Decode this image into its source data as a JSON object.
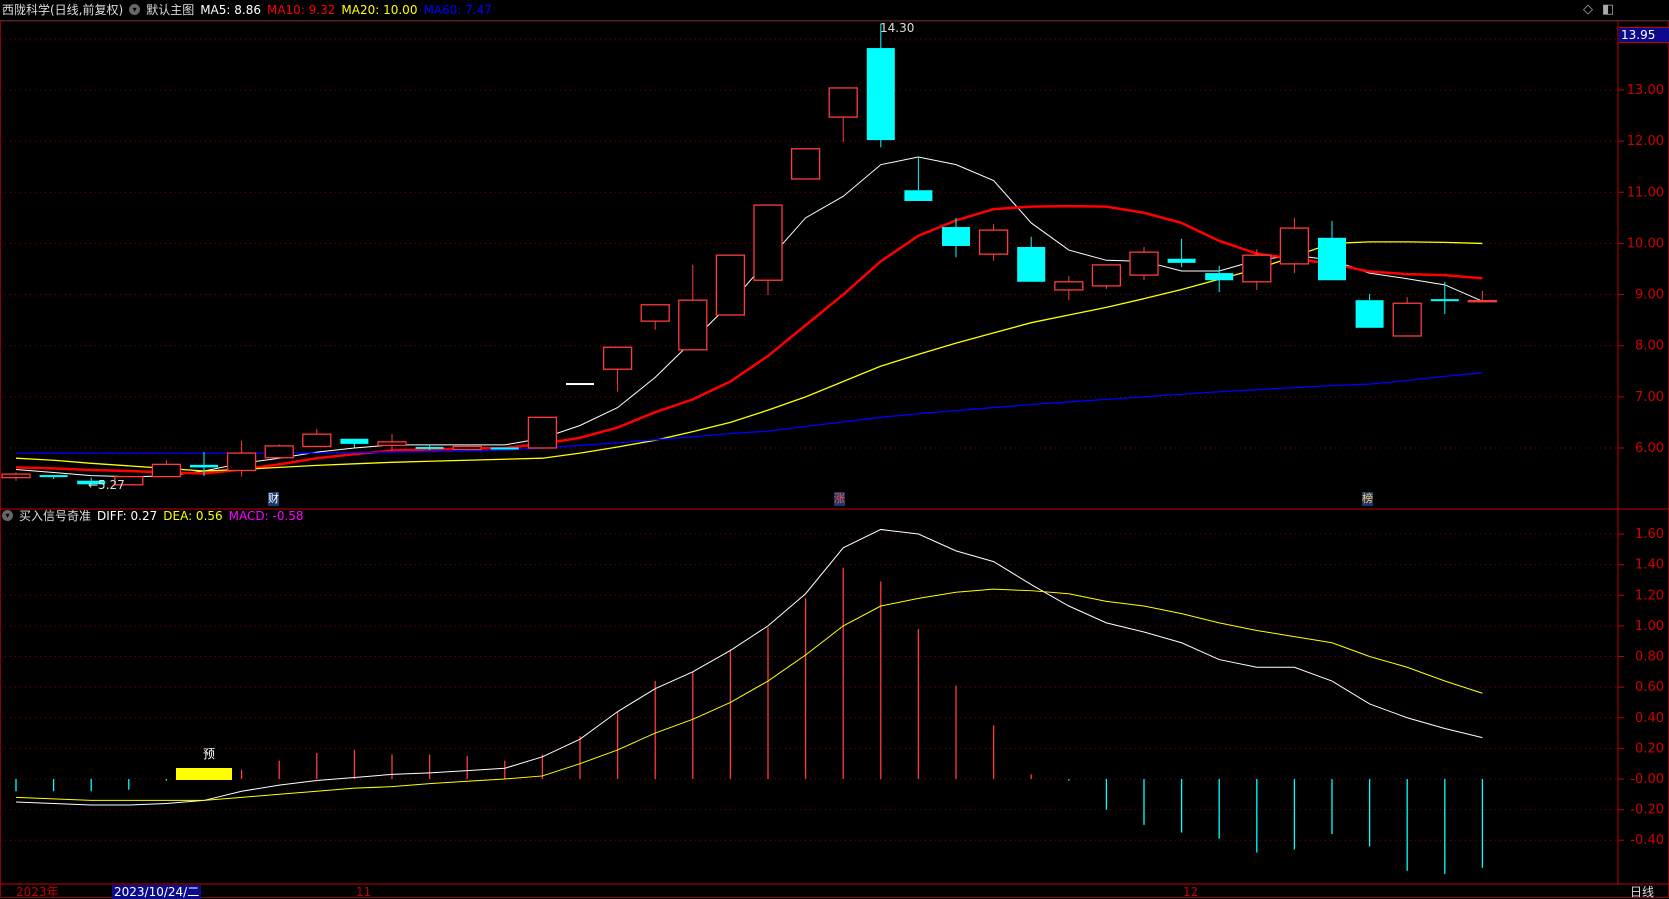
{
  "header": {
    "title": "西陇科学(日线,前复权)",
    "template": "默认主图",
    "ma5": "MA5: 8.86",
    "ma10": "MA10: 9.32",
    "ma20": "MA20: 10.00",
    "ma60": "MA60: 7.47"
  },
  "sub_header": {
    "indicator": "买入信号奇准",
    "diff": "DIFF: 0.27",
    "dea": "DEA: 0.56",
    "macd": "MACD: -0.58"
  },
  "colors": {
    "up": "#ff3b3b",
    "down": "#00ffff",
    "ma5": "#ffffff",
    "ma10": "#ff0000",
    "ma20": "#ffff00",
    "ma60": "#0000ff",
    "grid": "#8b0000",
    "axis": "#c00000"
  },
  "price_cursor_label": "13.95",
  "period_label": "日线",
  "date_bar": {
    "year": "2023年",
    "selected_date": "2023/10/24/二",
    "month_11": "11",
    "month_12": "12"
  },
  "markers": {
    "cai": "财",
    "zhang": "涨",
    "bang": "榜",
    "yu": "预",
    "low_label": "←5.27",
    "high_label": "14.30"
  },
  "chart_data": [
    {
      "type": "candlestick",
      "title": "西陇科学 日线",
      "y_ticks": [
        "13.00",
        "12.00",
        "11.00",
        "10.00",
        "9.00",
        "8.00",
        "7.00",
        "6.00"
      ],
      "ylim": [
        5.2,
        14.4
      ],
      "open": [
        5.42,
        5.47,
        5.36,
        5.28,
        5.44,
        5.67,
        5.56,
        5.81,
        6.03,
        6.18,
        6.05,
        6.02,
        5.97,
        6.01,
        6.0,
        7.27,
        7.54,
        8.48,
        7.92,
        8.6,
        9.28,
        11.26,
        12.47,
        13.82,
        11.04,
        10.32,
        9.79,
        9.93,
        9.09,
        9.17,
        9.38,
        9.7,
        9.42,
        9.25,
        9.6,
        10.11,
        8.89,
        8.19,
        8.91,
        8.86
      ],
      "close": [
        5.49,
        5.43,
        5.29,
        5.44,
        5.68,
        5.62,
        5.9,
        6.04,
        6.27,
        6.08,
        6.12,
        6.01,
        6.03,
        6.0,
        6.6,
        7.27,
        7.97,
        8.8,
        8.89,
        9.77,
        10.75,
        11.85,
        13.04,
        12.02,
        10.83,
        9.95,
        10.26,
        9.25,
        9.25,
        9.58,
        9.83,
        9.62,
        9.28,
        9.77,
        10.3,
        9.28,
        8.35,
        8.83,
        8.91,
        8.88
      ],
      "high": [
        5.52,
        5.47,
        5.42,
        5.44,
        5.76,
        5.92,
        6.14,
        6.07,
        6.37,
        6.18,
        6.27,
        6.06,
        6.05,
        6.01,
        6.6,
        7.27,
        7.97,
        8.8,
        9.58,
        9.77,
        10.75,
        11.85,
        13.04,
        14.3,
        11.69,
        10.5,
        10.38,
        10.13,
        9.36,
        9.58,
        9.93,
        10.09,
        9.56,
        9.89,
        10.5,
        10.44,
        9.01,
        8.95,
        9.25,
        9.07
      ],
      "low": [
        5.36,
        5.39,
        5.27,
        5.27,
        5.44,
        5.45,
        5.44,
        5.81,
        6.03,
        6.01,
        5.94,
        5.96,
        5.95,
        5.99,
        5.98,
        7.27,
        7.1,
        8.31,
        7.92,
        8.6,
        8.99,
        11.26,
        11.98,
        11.88,
        10.83,
        9.73,
        9.66,
        9.25,
        8.89,
        9.11,
        9.28,
        9.54,
        9.05,
        9.09,
        9.42,
        9.28,
        8.35,
        8.19,
        8.62,
        8.86
      ],
      "series": [
        {
          "name": "MA5",
          "values": [
            5.58,
            5.52,
            5.46,
            5.44,
            5.45,
            5.55,
            5.7,
            5.8,
            5.92,
            6.0,
            6.06,
            6.06,
            6.06,
            6.06,
            6.19,
            6.44,
            6.79,
            7.38,
            8.1,
            8.83,
            9.67,
            10.5,
            10.92,
            11.54,
            11.69,
            11.54,
            11.23,
            10.4,
            9.87,
            9.67,
            9.65,
            9.46,
            9.46,
            9.67,
            9.77,
            9.67,
            9.42,
            9.31,
            9.19,
            8.87
          ]
        },
        {
          "name": "MA10",
          "values": [
            5.62,
            5.6,
            5.57,
            5.55,
            5.52,
            5.5,
            5.58,
            5.68,
            5.8,
            5.88,
            5.95,
            5.97,
            5.99,
            6.0,
            6.08,
            6.2,
            6.4,
            6.7,
            6.95,
            7.3,
            7.8,
            8.4,
            9.0,
            9.65,
            10.15,
            10.45,
            10.67,
            10.72,
            10.73,
            10.72,
            10.6,
            10.4,
            10.05,
            9.8,
            9.7,
            9.6,
            9.45,
            9.4,
            9.38,
            9.32
          ]
        },
        {
          "name": "MA20",
          "values": [
            5.8,
            5.76,
            5.7,
            5.65,
            5.6,
            5.55,
            5.58,
            5.62,
            5.66,
            5.69,
            5.72,
            5.74,
            5.76,
            5.78,
            5.8,
            5.9,
            6.02,
            6.15,
            6.32,
            6.5,
            6.74,
            7.0,
            7.3,
            7.6,
            7.83,
            8.05,
            8.25,
            8.45,
            8.6,
            8.75,
            8.92,
            9.1,
            9.3,
            9.5,
            9.75,
            10.0,
            10.03,
            10.03,
            10.02,
            10.0
          ]
        },
        {
          "name": "MA60",
          "values": [
            5.9,
            5.9,
            5.9,
            5.9,
            5.9,
            5.9,
            5.9,
            5.9,
            5.9,
            5.91,
            5.92,
            5.93,
            5.94,
            5.96,
            6.0,
            6.05,
            6.1,
            6.16,
            6.22,
            6.28,
            6.33,
            6.42,
            6.51,
            6.6,
            6.67,
            6.73,
            6.79,
            6.85,
            6.9,
            6.95,
            7.0,
            7.05,
            7.1,
            7.14,
            7.18,
            7.22,
            7.25,
            7.32,
            7.4,
            7.47
          ]
        }
      ]
    },
    {
      "type": "macd",
      "y_ticks": [
        "1.60",
        "1.40",
        "1.20",
        "1.00",
        "0.80",
        "0.60",
        "0.40",
        "0.20",
        "-0.00",
        "-0.20",
        "-0.40"
      ],
      "ylim": [
        -0.55,
        1.75
      ],
      "diff": [
        -0.15,
        -0.16,
        -0.17,
        -0.17,
        -0.16,
        -0.14,
        -0.08,
        -0.04,
        -0.01,
        0.01,
        0.03,
        0.04,
        0.055,
        0.07,
        0.145,
        0.26,
        0.44,
        0.59,
        0.7,
        0.84,
        1.0,
        1.21,
        1.51,
        1.63,
        1.6,
        1.49,
        1.42,
        1.27,
        1.13,
        1.02,
        0.96,
        0.89,
        0.78,
        0.73,
        0.73,
        0.64,
        0.49,
        0.4,
        0.33,
        0.27
      ],
      "dea": [
        -0.12,
        -0.13,
        -0.14,
        -0.14,
        -0.14,
        -0.14,
        -0.12,
        -0.1,
        -0.08,
        -0.06,
        -0.05,
        -0.03,
        -0.015,
        0.0,
        0.02,
        0.1,
        0.19,
        0.3,
        0.39,
        0.5,
        0.64,
        0.81,
        1.0,
        1.13,
        1.18,
        1.22,
        1.24,
        1.23,
        1.21,
        1.16,
        1.13,
        1.08,
        1.02,
        0.97,
        0.93,
        0.89,
        0.8,
        0.73,
        0.64,
        0.56
      ],
      "macd": [
        -0.08,
        -0.08,
        -0.08,
        -0.07,
        -0.01,
        0.0,
        0.06,
        0.12,
        0.17,
        0.19,
        0.16,
        0.16,
        0.15,
        0.12,
        0.16,
        0.28,
        0.44,
        0.64,
        0.7,
        0.84,
        0.99,
        1.18,
        1.38,
        1.29,
        0.98,
        0.61,
        0.35,
        0.03,
        -0.01,
        -0.2,
        -0.3,
        -0.35,
        -0.39,
        -0.48,
        -0.46,
        -0.36,
        -0.44,
        -0.6,
        -0.62,
        -0.58
      ]
    }
  ]
}
